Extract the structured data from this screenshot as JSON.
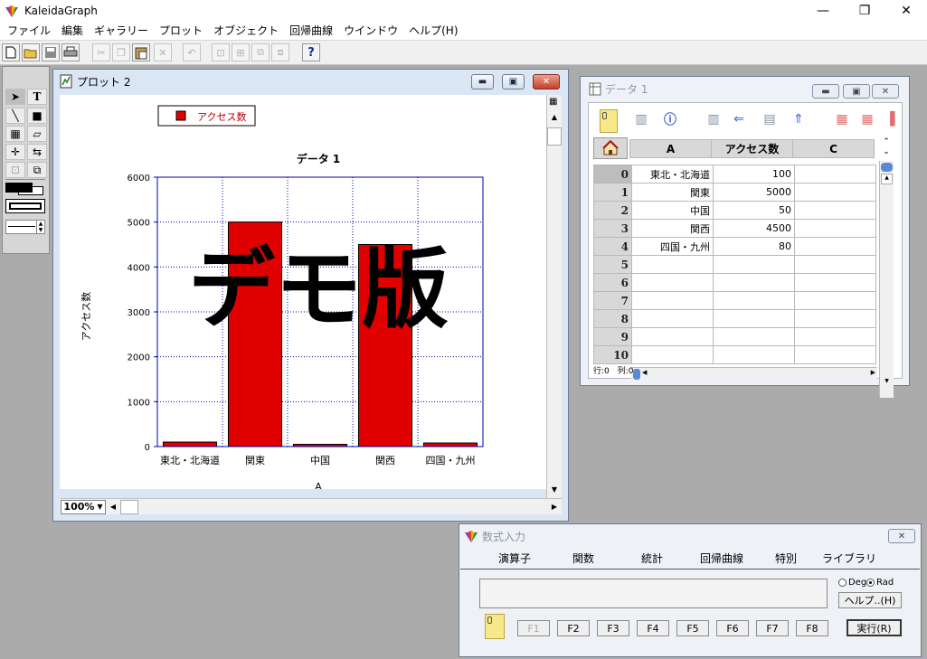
{
  "app": {
    "title": "KaleidaGraph",
    "minimize": "—",
    "restore": "❐",
    "close": "✕"
  },
  "menu": [
    "ファイル",
    "編集",
    "ギャラリー",
    "プロット",
    "オブジェクト",
    "回帰曲線",
    "ウインドウ",
    "ヘルプ(H)"
  ],
  "toolbar": {
    "help_label": "?"
  },
  "plot_window": {
    "title": "プロット 2",
    "zoom": "100%",
    "watermark": "デモ版"
  },
  "chart_data": {
    "type": "bar",
    "title": "データ 1",
    "xlabel": "A",
    "ylabel": "アクセス数",
    "categories": [
      "東北・北海道",
      "関東",
      "中国",
      "関西",
      "四国・九州"
    ],
    "series": [
      {
        "name": "アクセス数",
        "values": [
          100,
          5000,
          50,
          4500,
          80
        ],
        "color": "#e00000"
      }
    ],
    "ylim": [
      0,
      6000
    ],
    "yticks": [
      0,
      1000,
      2000,
      3000,
      4000,
      5000,
      6000
    ],
    "grid": true,
    "legend": "top-left"
  },
  "data_window": {
    "title": "データ 1",
    "columns": [
      "A",
      "アクセス数",
      "C"
    ],
    "rows": [
      {
        "index": "0",
        "a": "東北・北海道",
        "b": "100",
        "c": ""
      },
      {
        "index": "1",
        "a": "関東",
        "b": "5000",
        "c": ""
      },
      {
        "index": "2",
        "a": "中国",
        "b": "50",
        "c": ""
      },
      {
        "index": "3",
        "a": "関西",
        "b": "4500",
        "c": ""
      },
      {
        "index": "4",
        "a": "四国・九州",
        "b": "80",
        "c": ""
      },
      {
        "index": "5",
        "a": "",
        "b": "",
        "c": ""
      },
      {
        "index": "6",
        "a": "",
        "b": "",
        "c": ""
      },
      {
        "index": "7",
        "a": "",
        "b": "",
        "c": ""
      },
      {
        "index": "8",
        "a": "",
        "b": "",
        "c": ""
      },
      {
        "index": "9",
        "a": "",
        "b": "",
        "c": ""
      },
      {
        "index": "10",
        "a": "",
        "b": "",
        "c": ""
      }
    ],
    "status": "行:0　列:0"
  },
  "formula_window": {
    "title": "数式入力",
    "menu": [
      "演算子",
      "関数",
      "統計",
      "回帰曲線",
      "特別",
      "ライブラリ"
    ],
    "deg_label": "Deg",
    "rad_label": "Rad",
    "angle_mode": "Rad",
    "help_button": "ヘルプ..(H)",
    "fkeys": [
      "F1",
      "F2",
      "F3",
      "F4",
      "F5",
      "F6",
      "F7",
      "F8"
    ],
    "run_button": "実行(R)",
    "input_value": ""
  }
}
